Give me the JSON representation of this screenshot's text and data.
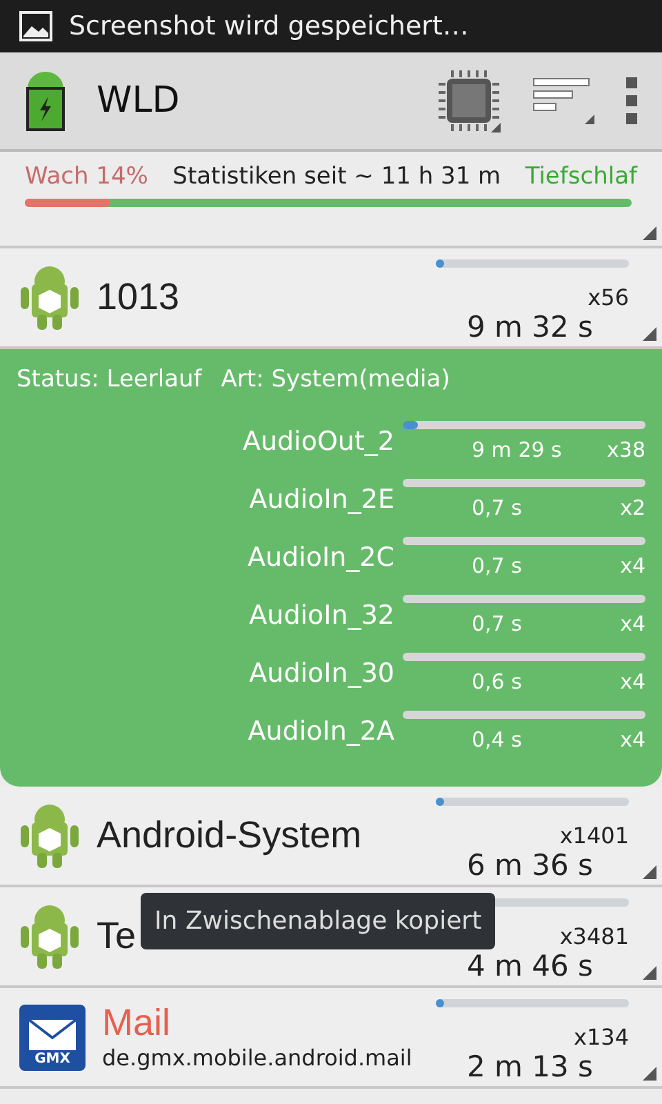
{
  "status_bar": {
    "notification": "Screenshot wird gespeichert…"
  },
  "action_bar": {
    "title": "WLD"
  },
  "summary": {
    "awake_label": "Wach 14%",
    "since": "Statistiken seit ~ 11 h 31 m",
    "deep_sleep_label": "Tiefschlaf",
    "level": 0.14
  },
  "items": [
    {
      "kind": "android",
      "name": "1013",
      "count": "x56",
      "duration": "9 m 32 s",
      "level": 0.04,
      "details": {
        "status": "Status: Leerlauf",
        "type": "Art: System(media)",
        "wakelocks": [
          {
            "name": "AudioOut_2",
            "duration": "9 m 29 s",
            "count": "x38",
            "level": 0.06
          },
          {
            "name": "AudioIn_2E",
            "duration": "0,7 s",
            "count": "x2",
            "level": 0
          },
          {
            "name": "AudioIn_2C",
            "duration": "0,7 s",
            "count": "x4",
            "level": 0
          },
          {
            "name": "AudioIn_32",
            "duration": "0,7 s",
            "count": "x4",
            "level": 0
          },
          {
            "name": "AudioIn_30",
            "duration": "0,6 s",
            "count": "x4",
            "level": 0
          },
          {
            "name": "AudioIn_2A",
            "duration": "0,4 s",
            "count": "x4",
            "level": 0
          }
        ]
      }
    },
    {
      "kind": "android",
      "name": "Android-System",
      "count": "x1401",
      "duration": "6 m 36 s",
      "level": 0.02
    },
    {
      "kind": "android",
      "name": "Te",
      "count": "x3481",
      "duration": "4 m 46 s"
    },
    {
      "kind": "mail",
      "name": "Mail",
      "package": "de.gmx.mobile.android.mail",
      "icon_label": "GMX",
      "count": "x134",
      "duration": "2 m 13 s",
      "level": 0.01
    }
  ],
  "toast": {
    "text": "In Zwischenablage kopiert"
  }
}
